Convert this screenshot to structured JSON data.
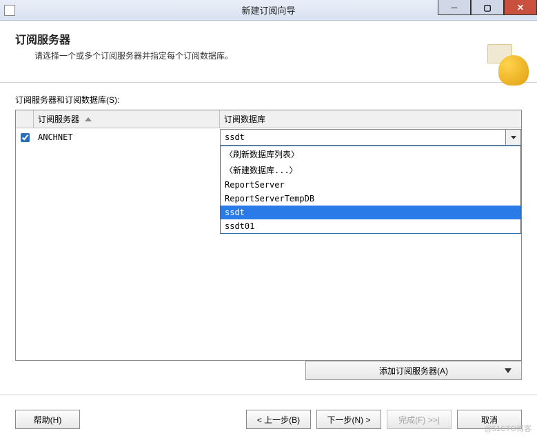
{
  "window": {
    "title": "新建订阅向导"
  },
  "header": {
    "title": "订阅服务器",
    "subtitle": "请选择一个或多个订阅服务器并指定每个订阅数据库。"
  },
  "grid": {
    "label": "订阅服务器和订阅数据库(S):",
    "col_server": "订阅服务器",
    "col_db": "订阅数据库",
    "row": {
      "server": "ANCHNET",
      "db_value": "ssdt"
    },
    "dropdown": {
      "items": [
        "〈刷新数据库列表〉",
        "〈新建数据库...〉",
        "ReportServer",
        "ReportServerTempDB",
        "ssdt",
        "ssdt01"
      ]
    }
  },
  "buttons": {
    "add_server": "添加订阅服务器(A)",
    "help": "帮助(H)",
    "back": "< 上一步(B)",
    "next": "下一步(N) >",
    "finish": "完成(F) >>|",
    "cancel": "取消"
  },
  "watermark": "@51CTO博客"
}
